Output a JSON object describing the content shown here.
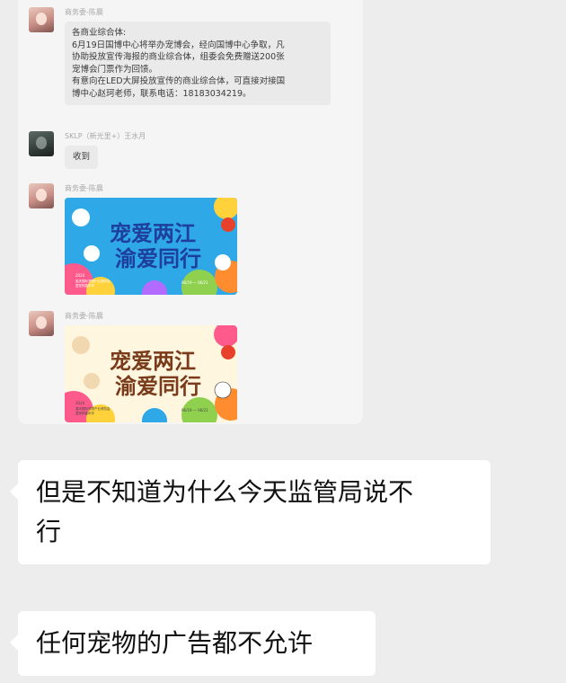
{
  "screenshot": {
    "messages": [
      {
        "sender": "商务委-陈晨",
        "lines": [
          "各商业综合体:",
          "6月19日国博中心将举办宠博会，经向国博中心争取，凡",
          "协助投放宣传海报的商业综合体，组委会免费赠送200张",
          "宠博会门票作为回馈。",
          "有意向在LED大屏投放宣传的商业综合体，可直接对接国",
          "博中心赵珂老师，联系电话：18183034219。"
        ]
      },
      {
        "sender": "SKLP（新光里+）王水月",
        "text": "收到"
      },
      {
        "sender": "商务委-陈晨",
        "poster": {
          "title_line1": "宠爱两江",
          "title_line2": "渝爱同行",
          "year": "2024",
          "fine_print_1": "重庆国际宠物产业博览会",
          "fine_print_2": "暨宠物嘉年华",
          "dates": "06/19 — 06/21"
        }
      },
      {
        "sender": "商务委-陈晨",
        "poster": {
          "title_line1": "宠爱两江",
          "title_line2": "渝爱同行",
          "year": "2024",
          "fine_print_1": "重庆国际宠物产业博览会",
          "fine_print_2": "暨宠物嘉年华",
          "dates": "06/19 — 06/21"
        }
      }
    ]
  },
  "chat": {
    "messages": [
      {
        "lines": [
          "但是不知道为什么今天监管局说不",
          "行"
        ]
      },
      {
        "lines": [
          "任何宠物的广告都不允许"
        ]
      }
    ]
  },
  "colors": {
    "background": "#ededed",
    "bubble": "#ffffff",
    "poster_blue": "#2fa8e8",
    "poster_title": "#1e3f9c"
  }
}
